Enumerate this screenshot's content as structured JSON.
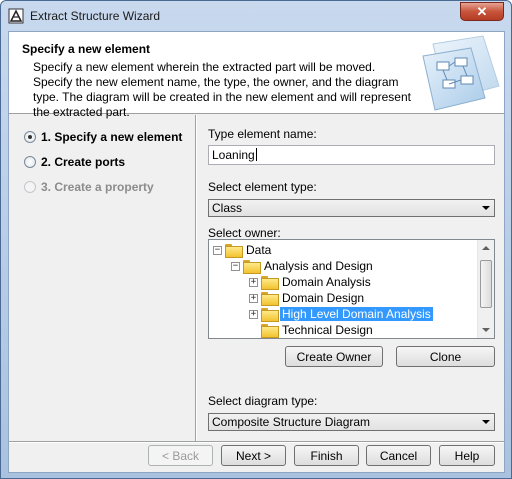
{
  "window": {
    "title": "Extract Structure Wizard",
    "close_symbol": "✕"
  },
  "header": {
    "title": "Specify a new element",
    "description": "Specify a new element wherein the extracted part will be moved. Specify the new element name, the type, the owner, and the diagram type. The diagram will be created in the new element and will represent the extracted part.",
    "art_icon": "wizard-diagram-illustration"
  },
  "steps": [
    {
      "label": "1. Specify a new element",
      "state": "current"
    },
    {
      "label": "2. Create ports",
      "state": "enabled"
    },
    {
      "label": "3. Create a property",
      "state": "disabled"
    }
  ],
  "form": {
    "name_label": "Type element name:",
    "name_value": "Loaning",
    "type_label": "Select element type:",
    "type_value": "Class",
    "owner_label": "Select owner:",
    "diagram_label": "Select diagram type:",
    "diagram_value": "Composite Structure Diagram"
  },
  "tree": {
    "items": [
      {
        "label": "Data",
        "expander": "−",
        "selected": false
      },
      {
        "label": "Analysis and Design",
        "expander": "−",
        "selected": false
      },
      {
        "label": "Domain Analysis",
        "expander": "+",
        "selected": false
      },
      {
        "label": "Domain Design",
        "expander": "+",
        "selected": false
      },
      {
        "label": "High Level Domain Analysis",
        "expander": "+",
        "selected": true
      },
      {
        "label": "Technical Design",
        "expander": "",
        "selected": false
      }
    ],
    "selected_color": "#3399ff"
  },
  "owner_buttons": {
    "create_owner": "Create Owner",
    "clone": "Clone"
  },
  "footer": {
    "back": "< Back",
    "next": "Next >",
    "finish": "Finish",
    "cancel": "Cancel",
    "help": "Help"
  }
}
